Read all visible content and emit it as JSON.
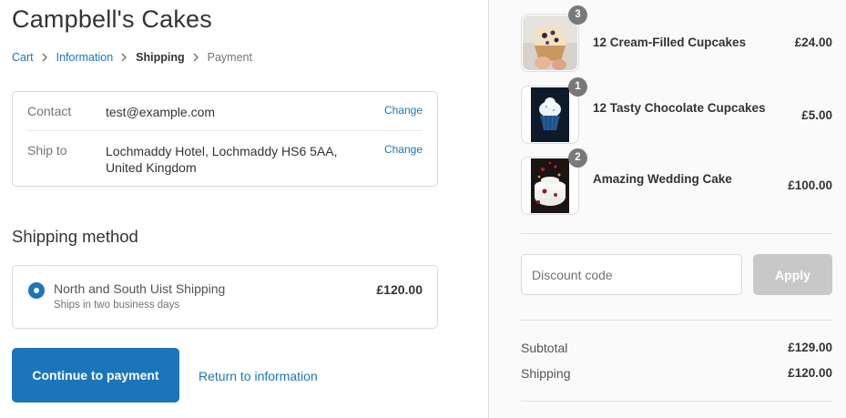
{
  "shop": {
    "name": "Campbell's Cakes"
  },
  "breadcrumb": [
    {
      "label": "Cart"
    },
    {
      "label": "Information"
    },
    {
      "label": "Shipping"
    },
    {
      "label": "Payment"
    }
  ],
  "review": {
    "contact": {
      "label": "Contact",
      "value": "test@example.com",
      "change": "Change"
    },
    "ship_to": {
      "label": "Ship to",
      "line1": "Lochmaddy Hotel, Lochmaddy HS6 5AA,",
      "line2": "United Kingdom",
      "change": "Change"
    }
  },
  "shipping_method": {
    "title": "Shipping method",
    "option": {
      "name": "North and South Uist Shipping",
      "note": "Ships in two business days",
      "price": "£120.00",
      "selected": true
    }
  },
  "actions": {
    "continue": "Continue to payment",
    "return": "Return to information"
  },
  "colors": {
    "accent": "#1b75bb",
    "apply_disabled": "#c8c8c8",
    "badge": "#727272"
  },
  "cart": {
    "items": [
      {
        "name": "12 Cream-Filled Cupcakes",
        "price": "£24.00",
        "qty": "3",
        "icon": "cupcake-photo"
      },
      {
        "name": "12 Tasty Chocolate Cupcakes",
        "price": "£5.00",
        "qty": "1",
        "icon": "chocolate-cupcake-photo"
      },
      {
        "name": "Amazing Wedding Cake",
        "price": "£100.00",
        "qty": "2",
        "icon": "wedding-cake-photo"
      }
    ],
    "discount": {
      "placeholder": "Discount code",
      "apply": "Apply"
    },
    "totals": {
      "subtotal": {
        "label": "Subtotal",
        "value": "£129.00"
      },
      "shipping": {
        "label": "Shipping",
        "value": "£120.00"
      }
    }
  }
}
